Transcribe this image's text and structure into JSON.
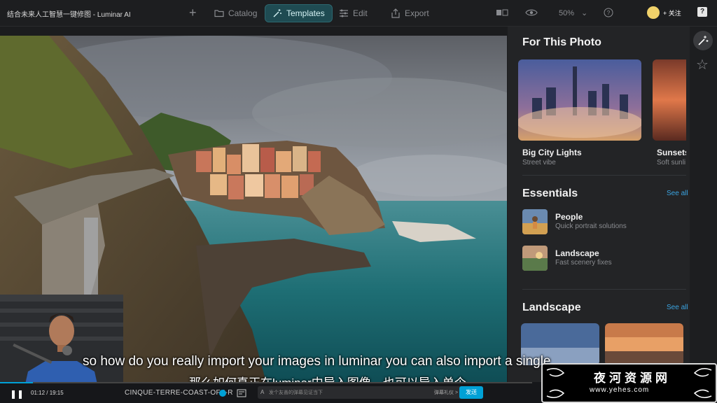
{
  "app": {
    "title": "结合未来人工智慧一键修图 - Luminar AI"
  },
  "toolbar": {
    "tabs": [
      {
        "label": "Catalog",
        "icon": "folder-icon"
      },
      {
        "label": "Templates",
        "icon": "magic-wand-icon",
        "active": true
      },
      {
        "label": "Edit",
        "icon": "sliders-icon"
      },
      {
        "label": "Export",
        "icon": "export-icon"
      }
    ],
    "zoom": "50%",
    "follow_label": "+ 关注"
  },
  "panel": {
    "for_this_photo": {
      "heading": "For This Photo",
      "cards": [
        {
          "title": "Big City Lights",
          "subtitle": "Street vibe"
        },
        {
          "title": "Sunsets",
          "subtitle": "Soft sunli"
        }
      ]
    },
    "essentials": {
      "heading": "Essentials",
      "see_all": "See all",
      "items": [
        {
          "title": "People",
          "subtitle": "Quick portrait solutions"
        },
        {
          "title": "Landscape",
          "subtitle": "Fast scenery fixes"
        }
      ]
    },
    "landscape": {
      "heading": "Landscape",
      "see_all": "See all"
    }
  },
  "subtitles": {
    "en": "so how do you really import your images in luminar you can also import a single",
    "zh": "那么如何真正在luminar中导入图像，也可以导入单个"
  },
  "player": {
    "time": "01:12 / 19:15",
    "progress": 0.062,
    "filename": "CINQUE-TERRE-COAST-OF-I-R",
    "danmaku_placeholder": "发个友善的弹幕见证当下",
    "danmaku_etiquette": "弹幕礼仪 >",
    "send_label": "发送"
  },
  "watermark": {
    "name": "夜河资源网",
    "url": "www.yehes.com"
  },
  "colors": {
    "accent": "#00a1d6",
    "active_tab": "#1f4b52",
    "link": "#3aa3e0"
  }
}
